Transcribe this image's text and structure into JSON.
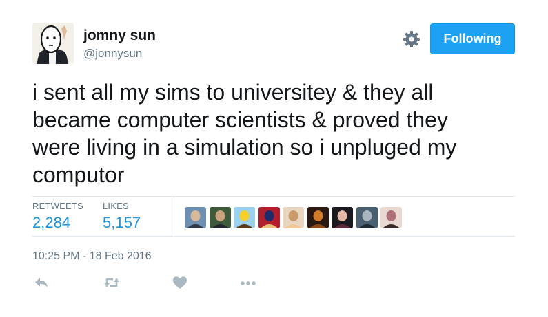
{
  "author": {
    "name": "jomny sun",
    "handle": "@jonnysun"
  },
  "header": {
    "follow_label": "Following",
    "settings_icon": "gear-icon"
  },
  "tweet": {
    "lines": [
      "i sent all my sims to universitey & they all",
      "became computer scientists & proved they",
      "were living in a simulation so i unpluged my",
      "computor"
    ],
    "timestamp": "10:25 PM - 18 Feb 2016"
  },
  "stats": {
    "retweets_label": "RETWEETS",
    "retweets_value": "2,284",
    "likes_label": "LIKES",
    "likes_value": "5,157"
  },
  "likers": [
    {
      "colors": [
        "#6f8fb0",
        "#d8b99a",
        "#2f3a4a"
      ]
    },
    {
      "colors": [
        "#3e5a3a",
        "#c9a27d",
        "#20272e"
      ]
    },
    {
      "colors": [
        "#9bd0ee",
        "#f5cf2a",
        "#5a3a1a"
      ]
    },
    {
      "colors": [
        "#b11e2e",
        "#1e2b6a",
        "#e8c27a"
      ]
    },
    {
      "colors": [
        "#e9d6c0",
        "#c89a6a",
        "#f1c79a"
      ]
    },
    {
      "colors": [
        "#2a1a12",
        "#d07a2a",
        "#8a4a1a"
      ]
    },
    {
      "colors": [
        "#1a1a1f",
        "#e2b8a6",
        "#5a2a3a"
      ]
    },
    {
      "colors": [
        "#4a6070",
        "#a8b4bf",
        "#1f2a33"
      ]
    },
    {
      "colors": [
        "#e8d8d0",
        "#b0707a",
        "#3a2a2a"
      ]
    }
  ],
  "actions": {
    "reply_icon": "reply-icon",
    "retweet_icon": "retweet-icon",
    "like_icon": "heart-icon",
    "more_icon": "more-dots-icon"
  },
  "colors": {
    "accent": "#1da1f2",
    "stat_value": "#1b95e0",
    "muted": "#657786",
    "icon": "#aab8c2",
    "divider": "#e1e8ed"
  }
}
